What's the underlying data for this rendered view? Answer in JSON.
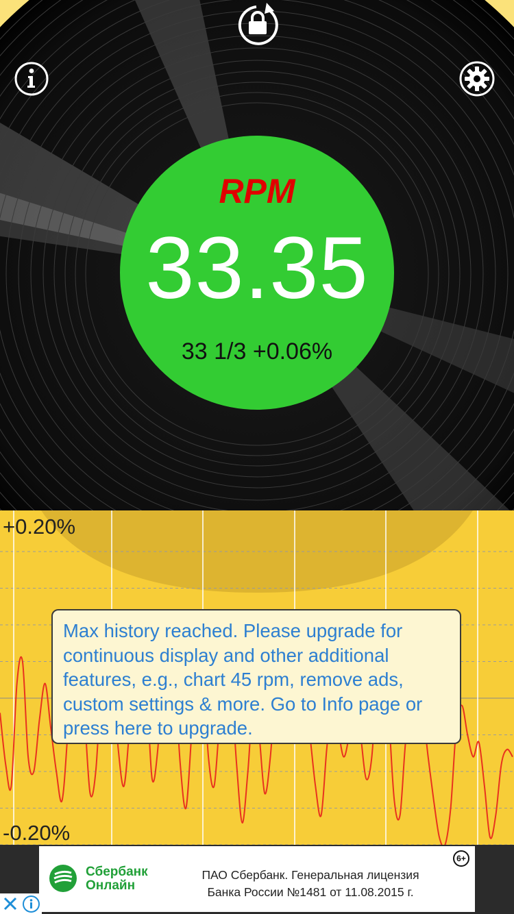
{
  "meter": {
    "label": "RPM",
    "value": "33.35",
    "detail": "33 1/3 +0.06%"
  },
  "toolbar": {
    "info_icon": "info-icon",
    "settings_icon": "gear-icon",
    "lock_icon": "rotation-lock-icon"
  },
  "chart": {
    "ymax_label": "+0.20%",
    "ymin_label": "-0.20%"
  },
  "chart_data": {
    "type": "line",
    "ylim": [
      -0.2,
      0.2
    ],
    "series": [
      {
        "color": "#e8321e",
        "values": [
          -0.02,
          -0.09,
          -0.12,
          0.02,
          0.05,
          -0.08,
          -0.1,
          -0.03,
          0.02,
          -0.04,
          -0.1,
          -0.14,
          -0.05,
          0.08,
          0.09,
          -0.02,
          -0.13,
          -0.1,
          0.02,
          0.06,
          0.03,
          -0.07,
          -0.12,
          -0.04,
          0.06,
          0.1,
          0.02,
          -0.11,
          -0.07,
          0.05,
          0.1,
          0.03,
          -0.09,
          -0.15,
          -0.05,
          0.07,
          0.04,
          -0.08,
          -0.12,
          -0.03,
          0.05,
          0.02,
          -0.09,
          -0.17,
          -0.1,
          0.0,
          -0.05,
          -0.13,
          -0.08,
          0.02,
          0.01,
          -0.03,
          -0.06,
          -0.02,
          0.01,
          -0.05,
          -0.12,
          -0.16,
          -0.07,
          0.0,
          -0.04,
          -0.08,
          -0.05,
          0.0,
          -0.05,
          -0.11,
          -0.08,
          0.03,
          0.1,
          -0.02,
          -0.14,
          -0.16,
          -0.06,
          -0.02,
          -0.04,
          -0.02,
          -0.08,
          -0.14,
          -0.19,
          -0.2,
          -0.15,
          -0.04,
          -0.01,
          -0.05,
          -0.08,
          -0.06,
          -0.12,
          -0.19,
          -0.16,
          -0.09,
          -0.07,
          -0.08
        ]
      }
    ]
  },
  "upgrade": {
    "message": "Max history reached.  Please upgrade for continuous display and other additional features, e.g., chart 45 rpm, remove ads, custom settings & more. Go to Info page or press here to upgrade."
  },
  "ad": {
    "brand_line1": "Сбербанк",
    "brand_line2": "Онлайн",
    "text_line1": "ПАО Сбербанк. Генеральная лицензия",
    "text_line2": "Банка России №1481 от 11.08.2015 г.",
    "age_rating": "6+",
    "brand_color": "#21a038",
    "close_icon": "close-icon",
    "info_icon": "ad-info-icon"
  }
}
